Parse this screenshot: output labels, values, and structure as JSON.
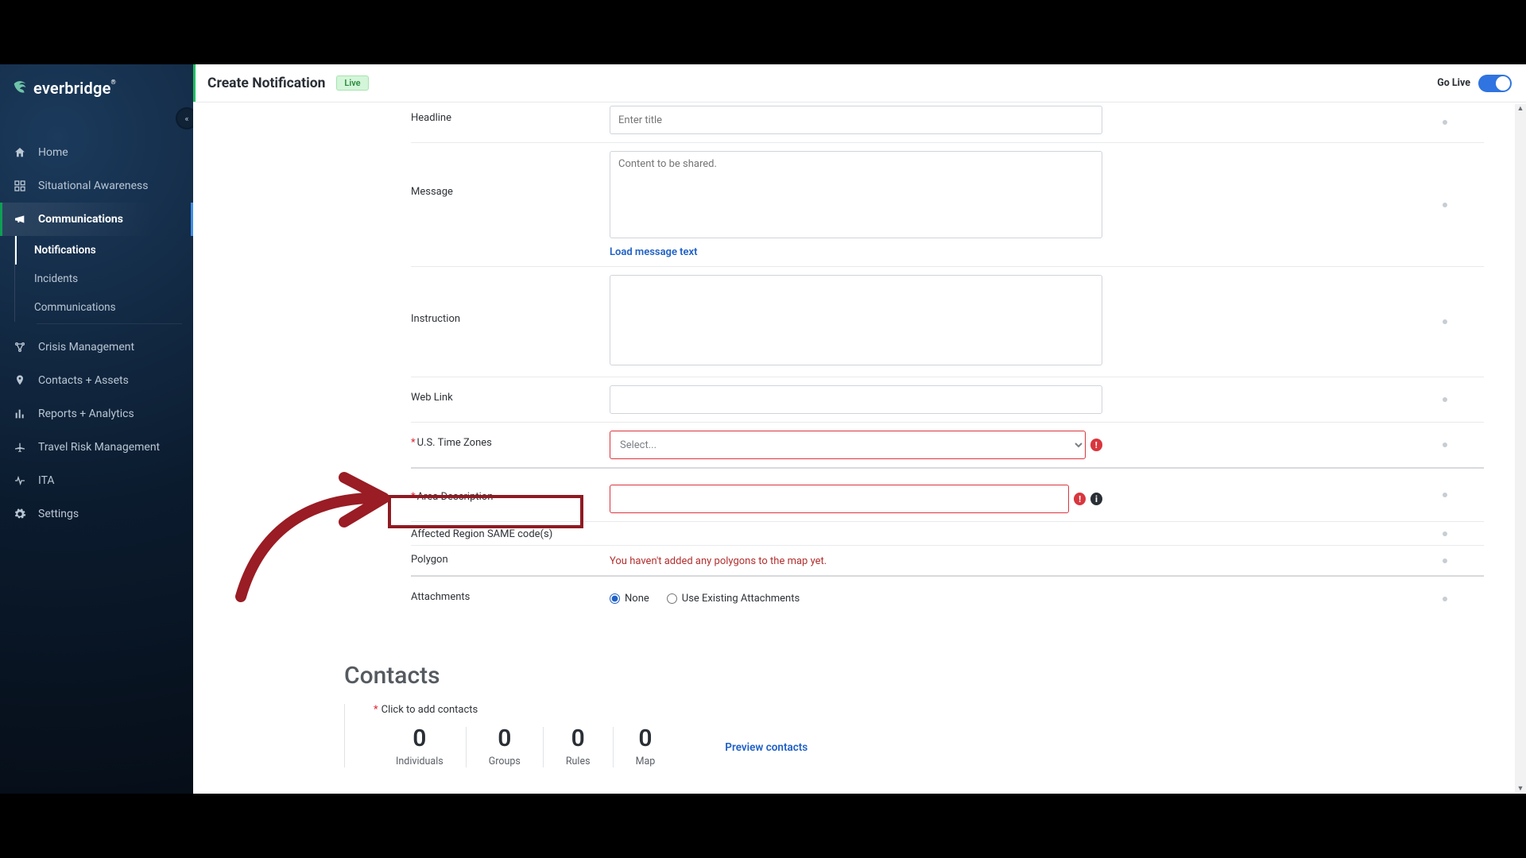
{
  "brand": {
    "name": "everbridge"
  },
  "sidebar": {
    "collapse_glyph": "«",
    "items": [
      {
        "label": "Home"
      },
      {
        "label": "Situational Awareness"
      },
      {
        "label": "Communications"
      },
      {
        "label": "Crisis Management"
      },
      {
        "label": "Contacts + Assets"
      },
      {
        "label": "Reports + Analytics"
      },
      {
        "label": "Travel Risk Management"
      },
      {
        "label": "ITA"
      },
      {
        "label": "Settings"
      }
    ],
    "comm_sub": [
      {
        "label": "Notifications"
      },
      {
        "label": "Incidents"
      },
      {
        "label": "Communications"
      }
    ]
  },
  "header": {
    "title": "Create Notification",
    "badge": "Live",
    "golive_label": "Go Live"
  },
  "form": {
    "headline": {
      "label": "Headline",
      "placeholder": "Enter title"
    },
    "message": {
      "label": "Message",
      "placeholder": "Content to be shared.",
      "load_link": "Load message text"
    },
    "instruction": {
      "label": "Instruction"
    },
    "weblink": {
      "label": "Web Link"
    },
    "timezones": {
      "label": "U.S. Time Zones",
      "placeholder": "Select..."
    },
    "area": {
      "label": "Area Description"
    },
    "same": {
      "label": "Affected Region SAME code(s)"
    },
    "polygon": {
      "label": "Polygon",
      "warn": "You haven't added any polygons to the map yet."
    },
    "attachments": {
      "label": "Attachments",
      "opt_none": "None",
      "opt_existing": "Use Existing Attachments"
    }
  },
  "contacts": {
    "heading": "Contacts",
    "hint": "Click to add contacts",
    "stats": [
      {
        "value": "0",
        "label": "Individuals"
      },
      {
        "value": "0",
        "label": "Groups"
      },
      {
        "value": "0",
        "label": "Rules"
      },
      {
        "value": "0",
        "label": "Map"
      }
    ],
    "preview": "Preview contacts"
  }
}
